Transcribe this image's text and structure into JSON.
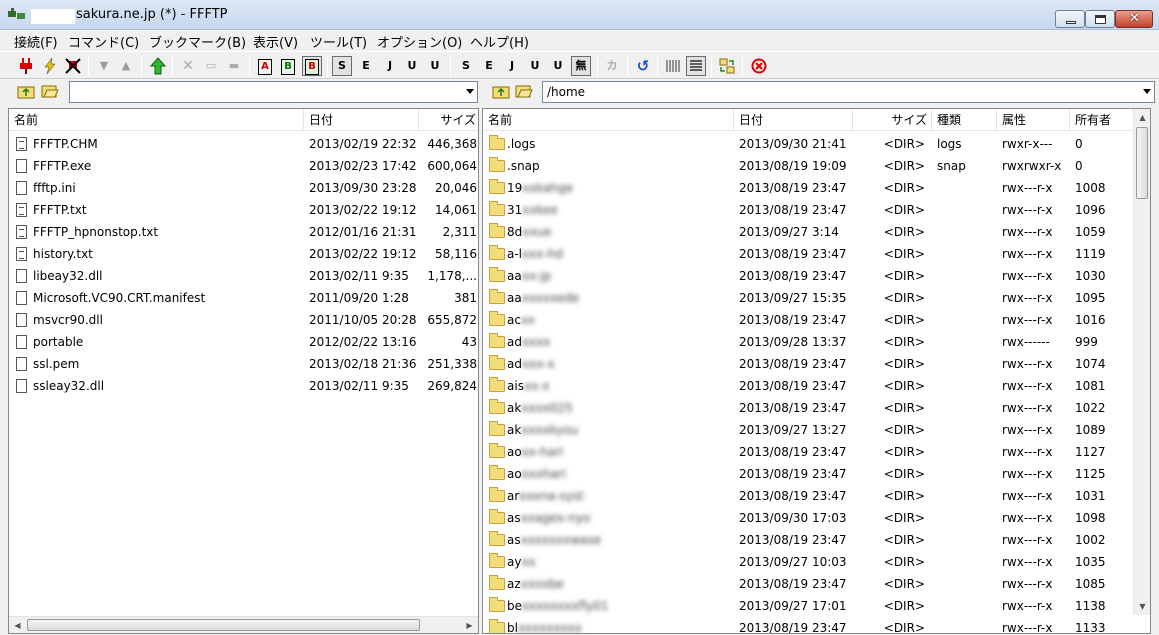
{
  "window": {
    "title": "sakura.ne.jp (*) - FFFTP",
    "minimize": "",
    "maximize": "",
    "close": "✕"
  },
  "menu": [
    "接続(F)",
    "コマンド(C)",
    "ブックマーク(B)",
    "表示(V)",
    "ツール(T)",
    "オプション(O)",
    "ヘルプ(H)"
  ],
  "toolbar": {
    "ascii_mode": "A",
    "binary_mode": "B",
    "auto_mode": "B",
    "sjis": "S",
    "euc": "E",
    "jis": "J",
    "utf8n": "U",
    "utf8bom": "U",
    "no_convert": "無",
    "kana": "カ"
  },
  "local": {
    "path": "",
    "columns": [
      "名前",
      "日付",
      "サイズ"
    ],
    "files": [
      {
        "name": "FFFTP.CHM",
        "date": "2013/02/19 22:32",
        "size": "446,368",
        "icon": "help-file-icon"
      },
      {
        "name": "FFFTP.exe",
        "date": "2013/02/23 17:42",
        "size": "600,064",
        "icon": "file-icon"
      },
      {
        "name": "ffftp.ini",
        "date": "2013/09/30 23:28",
        "size": "20,046",
        "icon": "file-icon"
      },
      {
        "name": "FFFTP.txt",
        "date": "2013/02/22 19:12",
        "size": "14,061",
        "icon": "text-file-icon"
      },
      {
        "name": "FFFTP_hpnonstop.txt",
        "date": "2012/01/16 21:31",
        "size": "2,311",
        "icon": "text-file-icon"
      },
      {
        "name": "history.txt",
        "date": "2013/02/22 19:12",
        "size": "58,116",
        "icon": "text-file-icon"
      },
      {
        "name": "libeay32.dll",
        "date": "2013/02/11  9:35",
        "size": "1,178,...",
        "icon": "file-icon"
      },
      {
        "name": "Microsoft.VC90.CRT.manifest",
        "date": "2011/09/20  1:28",
        "size": "381",
        "icon": "file-icon"
      },
      {
        "name": "msvcr90.dll",
        "date": "2011/10/05 20:28",
        "size": "655,872",
        "icon": "file-icon"
      },
      {
        "name": "portable",
        "date": "2012/02/22 13:16",
        "size": "43",
        "icon": "file-icon"
      },
      {
        "name": "ssl.pem",
        "date": "2013/02/18 21:36",
        "size": "251,338",
        "icon": "file-icon"
      },
      {
        "name": "ssleay32.dll",
        "date": "2013/02/11  9:35",
        "size": "269,824",
        "icon": "file-icon"
      }
    ]
  },
  "remote": {
    "path": "/home",
    "columns": [
      "名前",
      "日付",
      "サイズ",
      "種類",
      "属性",
      "所有者"
    ],
    "files": [
      {
        "name": ".logs",
        "hidden": "",
        "date": "2013/09/30 21:41",
        "size": "<DIR>",
        "type": "logs",
        "attr": "rwxr-x---",
        "owner": "0"
      },
      {
        "name": ".snap",
        "hidden": "",
        "date": "2013/08/19 19:09",
        "size": "<DIR>",
        "type": "snap",
        "attr": "rwxrwxr-x",
        "owner": "0"
      },
      {
        "name": "19",
        "hidden": "xxkahge",
        "date": "2013/08/19 23:47",
        "size": "<DIR>",
        "type": "",
        "attr": "rwx---r-x",
        "owner": "1008"
      },
      {
        "name": "31",
        "hidden": "xxkee",
        "date": "2013/08/19 23:47",
        "size": "<DIR>",
        "type": "",
        "attr": "rwx---r-x",
        "owner": "1096"
      },
      {
        "name": "8d",
        "hidden": "xxue",
        "date": "2013/09/27  3:14",
        "size": "<DIR>",
        "type": "",
        "attr": "rwx---r-x",
        "owner": "1059"
      },
      {
        "name": "a-l",
        "hidden": "xxx-hd",
        "date": "2013/08/19 23:47",
        "size": "<DIR>",
        "type": "",
        "attr": "rwx---r-x",
        "owner": "1119"
      },
      {
        "name": "aa",
        "hidden": "xx-jp",
        "date": "2013/08/19 23:47",
        "size": "<DIR>",
        "type": "",
        "attr": "rwx---r-x",
        "owner": "1030"
      },
      {
        "name": "aa",
        "hidden": "xxxxxede",
        "date": "2013/09/27 15:35",
        "size": "<DIR>",
        "type": "",
        "attr": "rwx---r-x",
        "owner": "1095"
      },
      {
        "name": "ac",
        "hidden": "xx",
        "date": "2013/08/19 23:47",
        "size": "<DIR>",
        "type": "",
        "attr": "rwx---r-x",
        "owner": "1016"
      },
      {
        "name": "ad",
        "hidden": "xxxx",
        "date": "2013/09/28 13:37",
        "size": "<DIR>",
        "type": "",
        "attr": "rwx------",
        "owner": "999"
      },
      {
        "name": "ad",
        "hidden": "xxx-x",
        "date": "2013/08/19 23:47",
        "size": "<DIR>",
        "type": "",
        "attr": "rwx---r-x",
        "owner": "1074"
      },
      {
        "name": "ais",
        "hidden": "xx-x",
        "date": "2013/08/19 23:47",
        "size": "<DIR>",
        "type": "",
        "attr": "rwx---r-x",
        "owner": "1081"
      },
      {
        "name": "ak",
        "hidden": "xxxx025",
        "date": "2013/08/19 23:47",
        "size": "<DIR>",
        "type": "",
        "attr": "rwx---r-x",
        "owner": "1022"
      },
      {
        "name": "ak",
        "hidden": "xxxxkyou",
        "date": "2013/09/27 13:27",
        "size": "<DIR>",
        "type": "",
        "attr": "rwx---r-x",
        "owner": "1089"
      },
      {
        "name": "ao",
        "hidden": "xx-hari",
        "date": "2013/08/19 23:47",
        "size": "<DIR>",
        "type": "",
        "attr": "rwx---r-x",
        "owner": "1127"
      },
      {
        "name": "ao",
        "hidden": "xxxhari",
        "date": "2013/08/19 23:47",
        "size": "<DIR>",
        "type": "",
        "attr": "rwx---r-x",
        "owner": "1125"
      },
      {
        "name": "ar",
        "hidden": "xxxna-syst",
        "date": "2013/08/19 23:47",
        "size": "<DIR>",
        "type": "",
        "attr": "rwx---r-x",
        "owner": "1031"
      },
      {
        "name": "as",
        "hidden": "xxagex-nyo",
        "date": "2013/09/30 17:03",
        "size": "<DIR>",
        "type": "",
        "attr": "rwx---r-x",
        "owner": "1098"
      },
      {
        "name": "as",
        "hidden": "xxxxxxxwase",
        "date": "2013/08/19 23:47",
        "size": "<DIR>",
        "type": "",
        "attr": "rwx---r-x",
        "owner": "1002"
      },
      {
        "name": "ay",
        "hidden": "xx",
        "date": "2013/09/27 10:03",
        "size": "<DIR>",
        "type": "",
        "attr": "rwx---r-x",
        "owner": "1035"
      },
      {
        "name": "az",
        "hidden": "xxxxbe",
        "date": "2013/08/19 23:47",
        "size": "<DIR>",
        "type": "",
        "attr": "rwx---r-x",
        "owner": "1085"
      },
      {
        "name": "be",
        "hidden": "xxxxxxxxfly01",
        "date": "2013/09/27 17:01",
        "size": "<DIR>",
        "type": "",
        "attr": "rwx---r-x",
        "owner": "1138"
      },
      {
        "name": "bl",
        "hidden": "xxxxxxxxx",
        "date": "2013/08/19 23:47",
        "size": "<DIR>",
        "type": "",
        "attr": "rwx---r-x",
        "owner": "1133"
      }
    ]
  },
  "colors": {
    "titlebar": "#c6d8ee",
    "window_bg": "#f0f0f0",
    "close_button": "#c4412a",
    "folder": "#f3dc7a"
  }
}
